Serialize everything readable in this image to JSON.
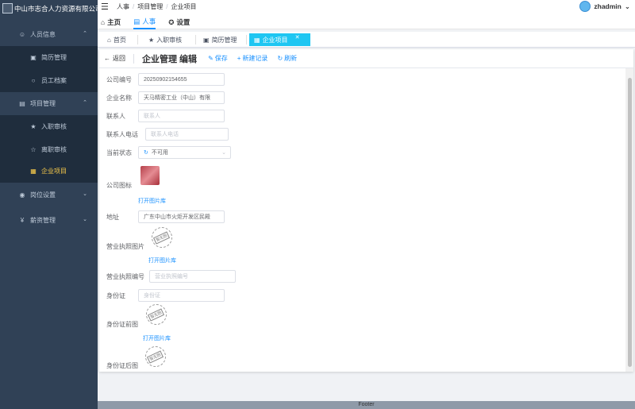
{
  "brand": "中山市志合人力资源有限公司",
  "sidebar": {
    "groups": [
      {
        "label": "人员信息",
        "icon": "user-icon"
      },
      {
        "label": "项目管理",
        "icon": "clipboard-icon"
      },
      {
        "label": "岗位设置",
        "icon": "globe-icon"
      },
      {
        "label": "薪资管理",
        "icon": "money-icon"
      }
    ],
    "items": [
      {
        "label": "简历管理",
        "icon": "resume-icon"
      },
      {
        "label": "员工档案",
        "icon": "person-icon"
      },
      {
        "label": "入职审核",
        "icon": "star-filled-icon"
      },
      {
        "label": "离职审核",
        "icon": "star-outline-icon"
      },
      {
        "label": "企业项目",
        "icon": "building-icon",
        "active": true
      }
    ]
  },
  "breadcrumb": [
    "人事",
    "项目管理",
    "企业项目"
  ],
  "topnav": [
    {
      "label": "主页",
      "icon": "home-icon"
    },
    {
      "label": "人事",
      "icon": "doc-icon",
      "active": true
    },
    {
      "label": "设置",
      "icon": "settings-icon"
    }
  ],
  "user": {
    "name": "zhadmin"
  },
  "tabs": [
    {
      "label": "首页"
    },
    {
      "label": "入职审核"
    },
    {
      "label": "简历管理"
    },
    {
      "label": "企业项目",
      "active": true
    }
  ],
  "page": {
    "back": "返回",
    "title": "企业管理 编辑",
    "actions": {
      "save": "保存",
      "new": "新建记录",
      "refresh": "刷新"
    }
  },
  "form": {
    "company_no": {
      "label": "公司编号",
      "value": "20250902154655"
    },
    "company_name": {
      "label": "企业名称",
      "value": "天马精密工业（中山）有限"
    },
    "contact": {
      "label": "联系人",
      "placeholder": "联系人"
    },
    "contact_phone": {
      "label": "联系人电话",
      "placeholder": "联系人电话"
    },
    "status": {
      "label": "当前状态",
      "value": "不可用"
    },
    "logo": {
      "label": "公司图标",
      "link": "打开图片库"
    },
    "address": {
      "label": "地址",
      "value": "广东中山市火炬开发区民殿"
    },
    "license_img": {
      "label": "营业执照图片",
      "link": "打开图片库",
      "stamp": "暂无图"
    },
    "license_no": {
      "label": "营业执照编号",
      "placeholder": "营业执照编号"
    },
    "id_card": {
      "label": "身份证",
      "placeholder": "身份证"
    },
    "id_front": {
      "label": "身份证前图",
      "link": "打开图片库",
      "stamp": "暂无图"
    },
    "id_back": {
      "label": "身份证后图",
      "stamp": "暂无图"
    }
  },
  "footer": "Footer",
  "colors": {
    "sidebar_bg": "#304156",
    "active_menu": "#ffd04b",
    "active_tab": "#1ec6f2",
    "link": "#1890ff"
  }
}
